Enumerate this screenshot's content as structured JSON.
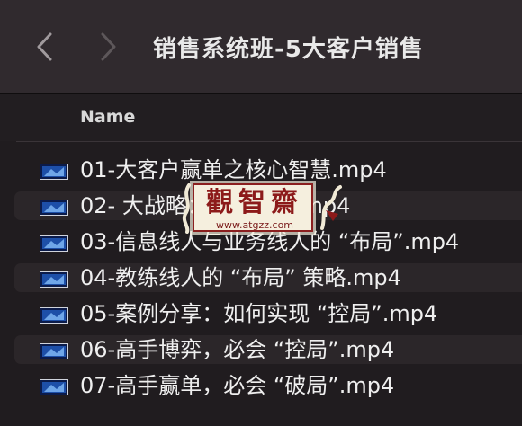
{
  "window": {
    "title": "销售系统班-5大客户销售"
  },
  "toolbar": {
    "back_icon": "chevron-left-icon",
    "forward_icon": "chevron-right-icon"
  },
  "list_header": {
    "column_name": "Name"
  },
  "files": [
    {
      "name": "01-大客户赢单之核心智慧.mp4",
      "icon": "video-file-icon"
    },
    {
      "name": "02- 大战略：谋篇布局.mp4",
      "icon": "video-file-icon"
    },
    {
      "name": "03-信息线人与业务线人的 “布局”.mp4",
      "icon": "video-file-icon"
    },
    {
      "name": "04-教练线人的 “布局” 策略.mp4",
      "icon": "video-file-icon"
    },
    {
      "name": "05-案例分享：如何实现 “控局”.mp4",
      "icon": "video-file-icon"
    },
    {
      "name": "06-高手博弈，必会 “控局”.mp4",
      "icon": "video-file-icon"
    },
    {
      "name": "07-高手赢单，必会 “破局”.mp4",
      "icon": "video-file-icon"
    }
  ],
  "watermark": {
    "logo_text": "觀智齋",
    "url": "www.atgzz.com"
  },
  "colors": {
    "toolbar_bg": "#302a2e",
    "list_bg": "#201c1f",
    "row_alt_bg": "#2b2629",
    "watermark_red": "#8c1a1a"
  }
}
